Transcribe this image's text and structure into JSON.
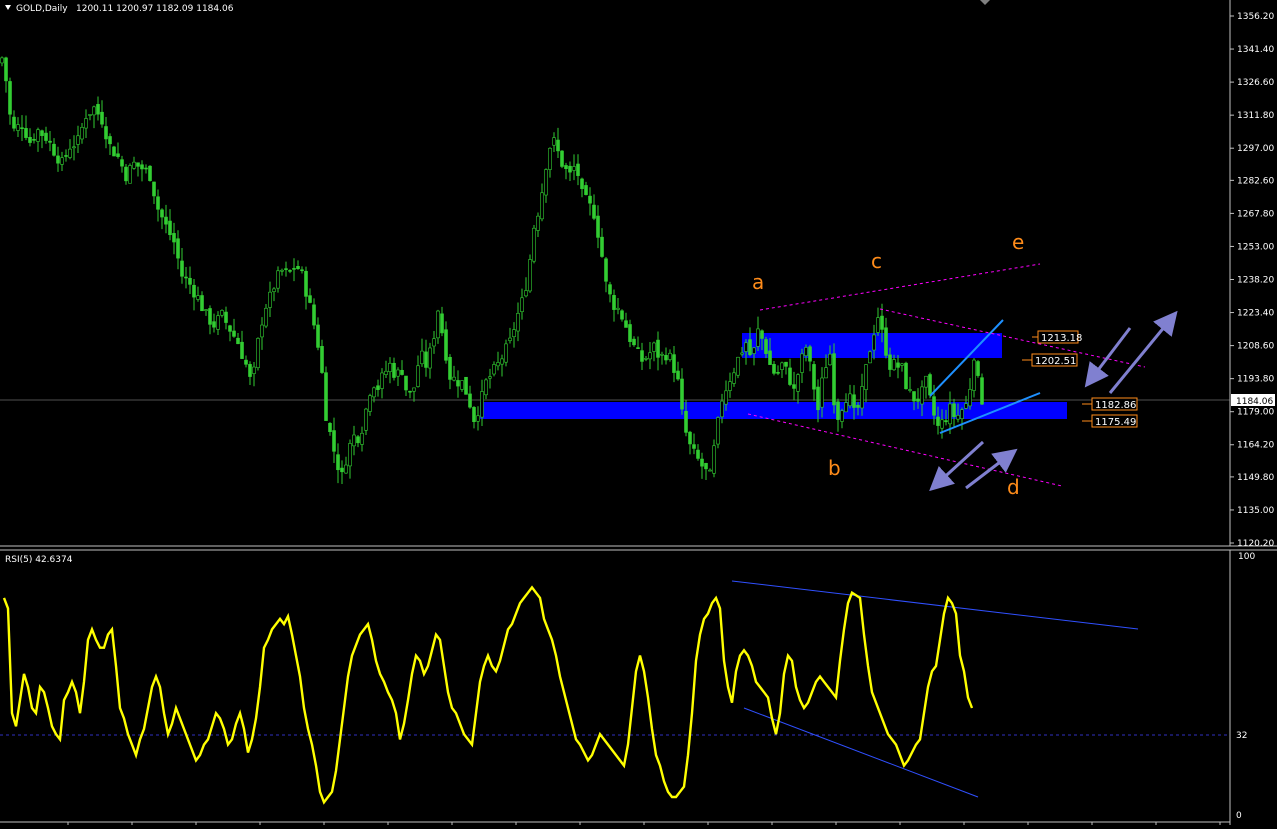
{
  "header": {
    "symbol": "GOLD,Daily",
    "ohlc": "1200.11 1200.97 1182.09 1184.06",
    "rsi_label": "RSI(5) 42.6374"
  },
  "colors": {
    "background": "#000000",
    "candle": "#32cd32",
    "zone": "#0000ff",
    "wave_label": "#ff8c1a",
    "channel": "#ff00ff",
    "wedge": "#1e90ff",
    "arrow": "#8080d0",
    "rsi_line": "#ffff00",
    "rsi_trend": "#3050ff"
  },
  "chart_data": [
    {
      "type": "candlestick",
      "title": "GOLD,Daily",
      "ylim": [
        1120.2,
        1356.2
      ],
      "y_ticks": [
        "1356.20",
        "1341.40",
        "1326.60",
        "1311.80",
        "1297.00",
        "1282.60",
        "1267.80",
        "1253.00",
        "1238.20",
        "1223.40",
        "1208.60",
        "1193.80",
        "1179.00",
        "1164.20",
        "1149.80",
        "1135.00",
        "1120.20"
      ],
      "current_price": "1184.06",
      "price_labels": [
        "1213.18",
        "1202.51",
        "1182.86",
        "1175.49"
      ],
      "wave_labels": [
        "a",
        "b",
        "c",
        "d",
        "e"
      ],
      "close_path": [
        [
          0,
          1335
        ],
        [
          4,
          1340
        ],
        [
          8,
          1315
        ],
        [
          14,
          1305
        ],
        [
          22,
          1308
        ],
        [
          30,
          1300
        ],
        [
          38,
          1305
        ],
        [
          46,
          1302
        ],
        [
          54,
          1296
        ],
        [
          62,
          1290
        ],
        [
          70,
          1298
        ],
        [
          78,
          1300
        ],
        [
          86,
          1312
        ],
        [
          94,
          1315
        ],
        [
          102,
          1310
        ],
        [
          110,
          1298
        ],
        [
          118,
          1293
        ],
        [
          126,
          1285
        ],
        [
          134,
          1290
        ],
        [
          142,
          1288
        ],
        [
          150,
          1285
        ],
        [
          158,
          1270
        ],
        [
          166,
          1262
        ],
        [
          174,
          1255
        ],
        [
          182,
          1240
        ],
        [
          190,
          1236
        ],
        [
          198,
          1230
        ],
        [
          206,
          1222
        ],
        [
          214,
          1218
        ],
        [
          222,
          1222
        ],
        [
          230,
          1216
        ],
        [
          238,
          1210
        ],
        [
          246,
          1200
        ],
        [
          252,
          1190
        ],
        [
          258,
          1210
        ],
        [
          264,
          1225
        ],
        [
          270,
          1230
        ],
        [
          276,
          1238
        ],
        [
          282,
          1242
        ],
        [
          288,
          1240
        ],
        [
          296,
          1245
        ],
        [
          302,
          1240
        ],
        [
          308,
          1230
        ],
        [
          314,
          1218
        ],
        [
          320,
          1205
        ],
        [
          326,
          1178
        ],
        [
          332,
          1165
        ],
        [
          338,
          1155
        ],
        [
          342,
          1150
        ],
        [
          348,
          1162
        ],
        [
          354,
          1168
        ],
        [
          360,
          1168
        ],
        [
          366,
          1180
        ],
        [
          372,
          1193
        ],
        [
          378,
          1190
        ],
        [
          384,
          1196
        ],
        [
          390,
          1200
        ],
        [
          396,
          1195
        ],
        [
          402,
          1198
        ],
        [
          408,
          1185
        ],
        [
          414,
          1190
        ],
        [
          420,
          1205
        ],
        [
          426,
          1200
        ],
        [
          432,
          1208
        ],
        [
          438,
          1225
        ],
        [
          444,
          1210
        ],
        [
          450,
          1195
        ],
        [
          456,
          1193
        ],
        [
          462,
          1192
        ],
        [
          468,
          1186
        ],
        [
          474,
          1176
        ],
        [
          480,
          1182
        ],
        [
          486,
          1192
        ],
        [
          492,
          1196
        ],
        [
          498,
          1200
        ],
        [
          504,
          1205
        ],
        [
          510,
          1210
        ],
        [
          516,
          1220
        ],
        [
          522,
          1228
        ],
        [
          528,
          1240
        ],
        [
          534,
          1262
        ],
        [
          540,
          1272
        ],
        [
          546,
          1290
        ],
        [
          552,
          1302
        ],
        [
          558,
          1295
        ],
        [
          564,
          1288
        ],
        [
          570,
          1285
        ],
        [
          576,
          1290
        ],
        [
          582,
          1276
        ],
        [
          588,
          1272
        ],
        [
          594,
          1268
        ],
        [
          600,
          1255
        ],
        [
          606,
          1236
        ],
        [
          612,
          1228
        ],
        [
          618,
          1225
        ],
        [
          624,
          1220
        ],
        [
          630,
          1212
        ],
        [
          636,
          1206
        ],
        [
          642,
          1202
        ],
        [
          648,
          1204
        ],
        [
          654,
          1208
        ],
        [
          660,
          1203
        ],
        [
          666,
          1205
        ],
        [
          672,
          1202
        ],
        [
          678,
          1192
        ],
        [
          682,
          1178
        ],
        [
          688,
          1165
        ],
        [
          694,
          1160
        ],
        [
          700,
          1156
        ],
        [
          706,
          1152
        ],
        [
          710,
          1150
        ],
        [
          716,
          1168
        ],
        [
          722,
          1185
        ],
        [
          728,
          1192
        ],
        [
          734,
          1198
        ],
        [
          740,
          1205
        ],
        [
          746,
          1210
        ],
        [
          752,
          1202
        ],
        [
          758,
          1215
        ],
        [
          764,
          1210
        ],
        [
          770,
          1200
        ],
        [
          776,
          1195
        ],
        [
          782,
          1200
        ],
        [
          788,
          1196
        ],
        [
          794,
          1188
        ],
        [
          800,
          1200
        ],
        [
          806,
          1208
        ],
        [
          812,
          1195
        ],
        [
          818,
          1180
        ],
        [
          824,
          1198
        ],
        [
          830,
          1205
        ],
        [
          836,
          1175
        ],
        [
          842,
          1182
        ],
        [
          848,
          1188
        ],
        [
          854,
          1178
        ],
        [
          860,
          1182
        ],
        [
          866,
          1198
        ],
        [
          872,
          1212
        ],
        [
          878,
          1222
        ],
        [
          884,
          1210
        ],
        [
          890,
          1200
        ],
        [
          896,
          1200
        ],
        [
          902,
          1198
        ],
        [
          908,
          1188
        ],
        [
          914,
          1185
        ],
        [
          920,
          1185
        ],
        [
          926,
          1192
        ],
        [
          932,
          1180
        ],
        [
          938,
          1172
        ],
        [
          944,
          1175
        ],
        [
          950,
          1180
        ],
        [
          956,
          1176
        ],
        [
          962,
          1180
        ],
        [
          968,
          1183
        ],
        [
          974,
          1205
        ],
        [
          980,
          1186
        ],
        [
          983,
          1184
        ]
      ]
    },
    {
      "type": "line",
      "title": "RSI(5) 42.6374",
      "ylim": [
        0,
        100
      ],
      "y_ticks": [
        "100",
        "32",
        "0"
      ],
      "x": [
        0,
        4,
        8,
        12,
        16,
        20,
        24,
        28,
        32,
        36,
        40,
        44,
        48,
        52,
        56,
        60,
        64,
        68,
        72,
        76,
        80,
        84,
        88,
        92,
        96,
        100,
        104,
        108,
        112,
        116,
        120,
        124,
        128,
        132,
        136,
        140,
        144,
        148,
        152,
        156,
        160,
        164,
        168,
        172,
        176,
        180,
        184,
        188,
        192,
        196,
        200,
        204,
        208,
        212,
        216,
        220,
        224,
        228,
        232,
        236,
        240,
        244,
        248,
        252,
        256,
        260,
        264,
        268,
        272,
        276,
        280,
        284,
        288,
        292,
        296,
        300,
        304,
        308,
        312,
        316,
        320,
        324,
        328,
        332,
        336,
        340,
        344,
        348,
        352,
        356,
        360,
        364,
        368,
        372,
        376,
        380,
        384,
        388,
        392,
        396,
        400,
        404,
        408,
        412,
        416,
        420,
        424,
        428,
        432,
        436,
        440,
        444,
        448,
        452,
        456,
        460,
        464,
        468,
        472,
        476,
        480,
        484,
        488,
        492,
        496,
        500,
        504,
        508,
        512,
        516,
        520,
        524,
        528,
        532,
        536,
        540,
        544,
        548,
        552,
        556,
        560,
        564,
        568,
        572,
        576,
        580,
        584,
        588,
        592,
        596,
        600,
        604,
        608,
        612,
        616,
        620,
        624,
        628,
        632,
        636,
        640,
        644,
        648,
        652,
        656,
        660,
        664,
        668,
        672,
        676,
        680,
        684,
        688,
        692,
        696,
        700,
        704,
        708,
        712,
        716,
        720,
        724,
        728,
        732,
        736,
        740,
        744,
        748,
        752,
        756,
        760,
        764,
        768,
        772,
        776,
        780,
        784,
        788,
        792,
        796,
        800,
        804,
        808,
        812,
        816,
        820,
        824,
        828,
        832,
        836,
        840,
        844,
        848,
        852,
        856,
        860,
        864,
        868,
        872,
        876,
        880,
        884,
        888,
        892,
        896,
        900,
        904,
        908,
        912,
        916,
        920,
        924,
        928,
        932,
        936,
        940,
        944,
        948,
        952,
        956,
        960,
        964,
        968,
        972,
        976,
        980
      ],
      "values": [
        84,
        80,
        40,
        35,
        45,
        55,
        50,
        42,
        40,
        50,
        48,
        42,
        35,
        32,
        30,
        45,
        48,
        52,
        48,
        40,
        52,
        68,
        72,
        68,
        65,
        65,
        70,
        72,
        58,
        42,
        38,
        32,
        28,
        24,
        30,
        34,
        42,
        50,
        54,
        50,
        40,
        32,
        36,
        42,
        38,
        34,
        30,
        26,
        22,
        24,
        28,
        30,
        35,
        40,
        38,
        34,
        28,
        30,
        36,
        40,
        34,
        25,
        30,
        38,
        50,
        65,
        68,
        72,
        74,
        76,
        74,
        77,
        70,
        62,
        54,
        42,
        34,
        28,
        20,
        10,
        6,
        8,
        10,
        18,
        30,
        42,
        54,
        62,
        66,
        70,
        72,
        74,
        68,
        60,
        55,
        52,
        48,
        45,
        40,
        30,
        36,
        45,
        55,
        62,
        60,
        55,
        58,
        64,
        70,
        68,
        58,
        48,
        42,
        40,
        36,
        32,
        30,
        28,
        40,
        52,
        58,
        62,
        58,
        56,
        60,
        66,
        72,
        74,
        78,
        82,
        84,
        86,
        88,
        86,
        84,
        76,
        72,
        68,
        62,
        54,
        48,
        42,
        36,
        30,
        28,
        25,
        22,
        24,
        28,
        32,
        30,
        28,
        26,
        24,
        22,
        20,
        28,
        42,
        56,
        62,
        56,
        46,
        34,
        24,
        20,
        14,
        10,
        8,
        8,
        10,
        12,
        24,
        40,
        60,
        70,
        76,
        78,
        82,
        84,
        80,
        60,
        50,
        44,
        56,
        62,
        64,
        62,
        58,
        52,
        50,
        48,
        46,
        38,
        32,
        40,
        55,
        62,
        60,
        50,
        45,
        42,
        44,
        48,
        52,
        54,
        52,
        50,
        48,
        46,
        60,
        72,
        82,
        86,
        85,
        84,
        70,
        58,
        48,
        44,
        40,
        36,
        32,
        30,
        28,
        24,
        20,
        22,
        25,
        28,
        30,
        40,
        50,
        56,
        58,
        68,
        78,
        84,
        82,
        78,
        62,
        56,
        46,
        42
      ]
    }
  ]
}
